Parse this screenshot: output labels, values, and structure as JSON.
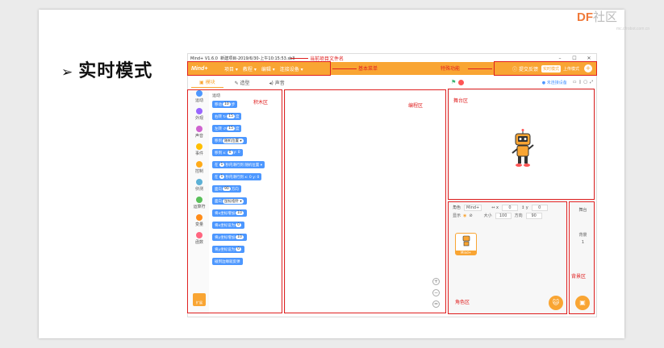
{
  "logo": {
    "main": "DF",
    "suffix": "社区",
    "url": "mc.dfrobot.com.cn"
  },
  "heading": {
    "arrow": "➢",
    "title": "实时模式"
  },
  "app": {
    "titlebar": {
      "app_name": "Mind+ V1.6.0",
      "project": "新建项目-2019/6/30-上午10:15:53.sb3",
      "min": "–",
      "max": "☐",
      "close": "✕"
    },
    "menu": {
      "brand": "Mind+",
      "items": [
        "项目 ▾",
        "教程 ▾",
        "编辑 ▾",
        "连接设备 ▾"
      ],
      "help": "ⓘ 提交反馈",
      "mode": "实时模式",
      "upload": "上传模式",
      "plus": "+"
    },
    "tabs": [
      "▣ 模块",
      "✎ 造型",
      "◂) 声音"
    ],
    "categories": [
      {
        "label": "运动",
        "color": "#4c97ff"
      },
      {
        "label": "外观",
        "color": "#9966ff"
      },
      {
        "label": "声音",
        "color": "#cf63cf"
      },
      {
        "label": "事件",
        "color": "#ffbf00"
      },
      {
        "label": "控制",
        "color": "#ffab19"
      },
      {
        "label": "侦测",
        "color": "#5cb1d6"
      },
      {
        "label": "运算符",
        "color": "#59c059"
      },
      {
        "label": "变量",
        "color": "#ff8c1a"
      },
      {
        "label": "函数",
        "color": "#ff6680"
      }
    ],
    "ext_label": "扩展",
    "blocks_title": "运动",
    "blocks": [
      {
        "pre": "移动",
        "slot": "10",
        "post": "步"
      },
      {
        "pre": "右转 ↻",
        "slot": "15",
        "post": "度"
      },
      {
        "pre": "左转 ↺",
        "slot": "15",
        "post": "度"
      },
      {
        "pre": "移到",
        "slot": "随机位置 ▾",
        "post": ""
      },
      {
        "pre": "移到 x:",
        "slot": "0",
        "post": "y: 0"
      },
      {
        "pre": "在",
        "slot": "1",
        "post": "秒内滑行到 随机位置 ▾"
      },
      {
        "pre": "在",
        "slot": "1",
        "post": "秒内滑行到 x: 0 y: 0"
      },
      {
        "pre": "面向",
        "slot": "90",
        "post": "方向"
      },
      {
        "pre": "面向",
        "slot": "鼠标指针 ▾",
        "post": ""
      },
      {
        "pre": "将x坐标增加",
        "slot": "10",
        "post": ""
      },
      {
        "pre": "将x坐标设为",
        "slot": "0",
        "post": ""
      },
      {
        "pre": "将y坐标增加",
        "slot": "10",
        "post": ""
      },
      {
        "pre": "将y坐标设为",
        "slot": "0",
        "post": ""
      },
      {
        "pre": "碰到边缘就反弹",
        "slot": "",
        "post": ""
      }
    ],
    "zoom": [
      "+",
      "−",
      "="
    ],
    "stage_toolbar": {
      "flag": "⚑",
      "device": "● 未连接设备",
      "buttons": [
        "▭",
        "▯",
        "▢",
        "⤢"
      ]
    },
    "sprite_panel": {
      "sprite_label": "角色",
      "sprite_name": "Mind+",
      "x_label": "↔ x",
      "x_value": "0",
      "y_label": "↕ y",
      "y_value": "0",
      "show_label": "显示",
      "size_label": "大小",
      "size_value": "100",
      "dir_label": "方向",
      "dir_value": "90",
      "thumb_name": "Mind+",
      "add_icon": "🐱"
    },
    "bg_panel": {
      "stage_label": "舞台",
      "bg_label": "背景",
      "bg_count": "1",
      "add_icon": "▣"
    }
  },
  "annotations": {
    "project_name": "当前项目文件名",
    "basic_menu": "基本菜单",
    "special": "特殊功能",
    "blocks_area": "积木区",
    "code_area": "编程区",
    "stage_area": "舞台区",
    "sprite_area": "角色区",
    "bg_area": "背景区"
  }
}
